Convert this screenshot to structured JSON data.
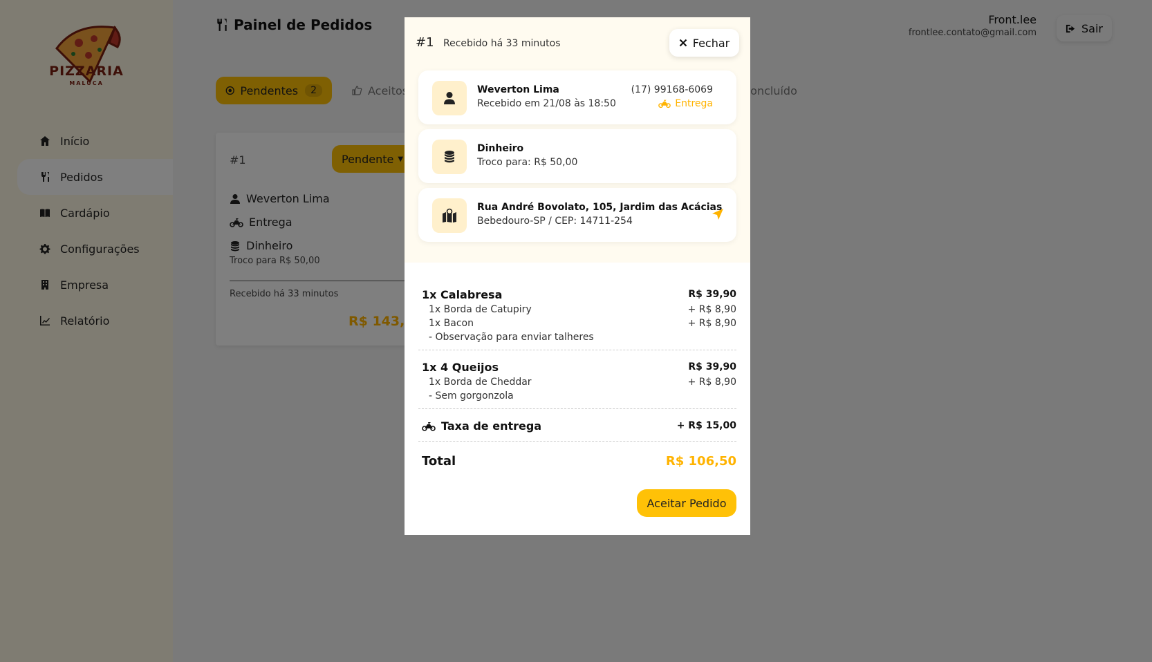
{
  "brand": {
    "name": "PIZZARIA",
    "sub": "MALUCA"
  },
  "sidebar": {
    "items": [
      {
        "label": "Início",
        "icon": "home-icon"
      },
      {
        "label": "Pedidos",
        "icon": "utensils-icon"
      },
      {
        "label": "Cardápio",
        "icon": "book-icon"
      },
      {
        "label": "Configurações",
        "icon": "gear-icon"
      },
      {
        "label": "Empresa",
        "icon": "building-icon"
      },
      {
        "label": "Relatório",
        "icon": "chart-icon"
      }
    ],
    "active": "Pedidos"
  },
  "header": {
    "title": "Painel de Pedidos",
    "user_name": "Front.lee",
    "user_email": "frontlee.contato@gmail.com",
    "logout_label": "Sair"
  },
  "tabs": [
    {
      "label": "Pendentes",
      "count": "2",
      "active": true
    },
    {
      "label": "Aceitos",
      "active": false
    },
    {
      "label": "Concluído",
      "active": false
    }
  ],
  "order_card": {
    "number": "#1",
    "status": "Pendente",
    "customer": "Weverton Lima",
    "delivery_type": "Entrega",
    "payment": "Dinheiro",
    "change": "Troco para R$ 50,00",
    "received": "Recebido há 33 minutos",
    "total": "R$ 143,50"
  },
  "modal": {
    "number": "#1",
    "received": "Recebido há 33 minutos",
    "close_label": "Fechar",
    "customer": {
      "name": "Weverton Lima",
      "received_at": "Recebido em 21/08 às 18:50",
      "phone": "(17) 99168-6069",
      "delivery_type": "Entrega"
    },
    "payment": {
      "method": "Dinheiro",
      "change": "Troco para: R$ 50,00"
    },
    "address": {
      "street": "Rua André Bovolato, 105, Jardim das Acácias",
      "city": "Bebedouro-SP / CEP: 14711-254"
    },
    "items": [
      {
        "name": "1x Calabresa",
        "price": "R$ 39,90",
        "extras": [
          {
            "label": "1x Borda de Catupiry",
            "price": "+ R$ 8,90"
          },
          {
            "label": "1x Bacon",
            "price": "+ R$ 8,90"
          }
        ],
        "note": "- Observação para enviar talheres"
      },
      {
        "name": "1x 4 Queijos",
        "price": "R$ 39,90",
        "extras": [
          {
            "label": "1x Borda de Cheddar",
            "price": "+ R$ 8,90"
          }
        ],
        "note": "- Sem gorgonzola"
      }
    ],
    "delivery_fee": {
      "label": "Taxa de entrega",
      "price": "+ R$ 15,00"
    },
    "total": {
      "label": "Total",
      "value": "R$ 106,50"
    },
    "accept_label": "Aceitar Pedido"
  },
  "colors": {
    "accent": "#ffc107",
    "accent_text": "#ffb300",
    "sidebar_bg": "#fff8e4"
  }
}
